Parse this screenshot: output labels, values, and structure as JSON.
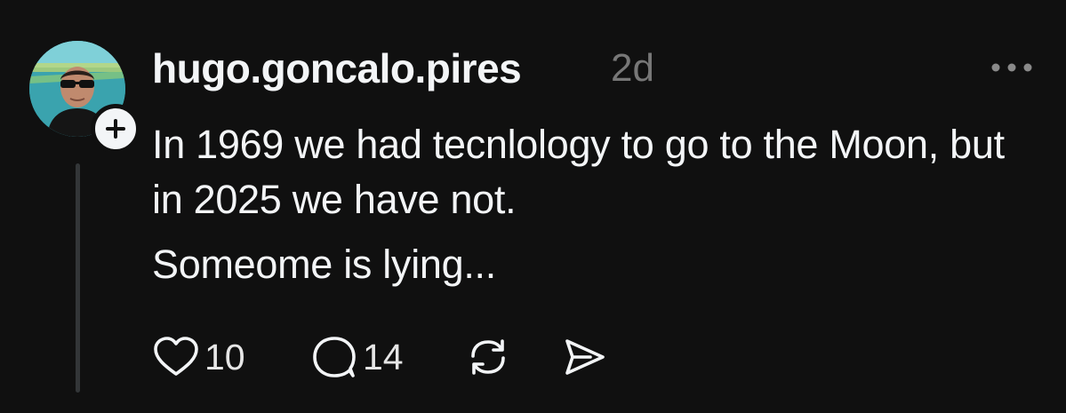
{
  "post": {
    "username": "hugo.goncalo.pires",
    "timestamp": "2d",
    "text_paragraphs": [
      "In 1969 we had tecnlology to go to the Moon, but in 2025 we have not.",
      "Someome is lying..."
    ]
  },
  "actions": {
    "like": {
      "icon": "heart-icon",
      "count": "10"
    },
    "reply": {
      "icon": "comment-icon",
      "count": "14"
    },
    "repost": {
      "icon": "repost-icon"
    },
    "share": {
      "icon": "share-icon"
    }
  },
  "icons": {
    "more": "more-horizontal-icon",
    "follow": "plus-icon"
  },
  "colors": {
    "background": "#101010",
    "primary_text": "#f3f5f7",
    "secondary_text": "#777777",
    "thread_line": "#333638"
  }
}
